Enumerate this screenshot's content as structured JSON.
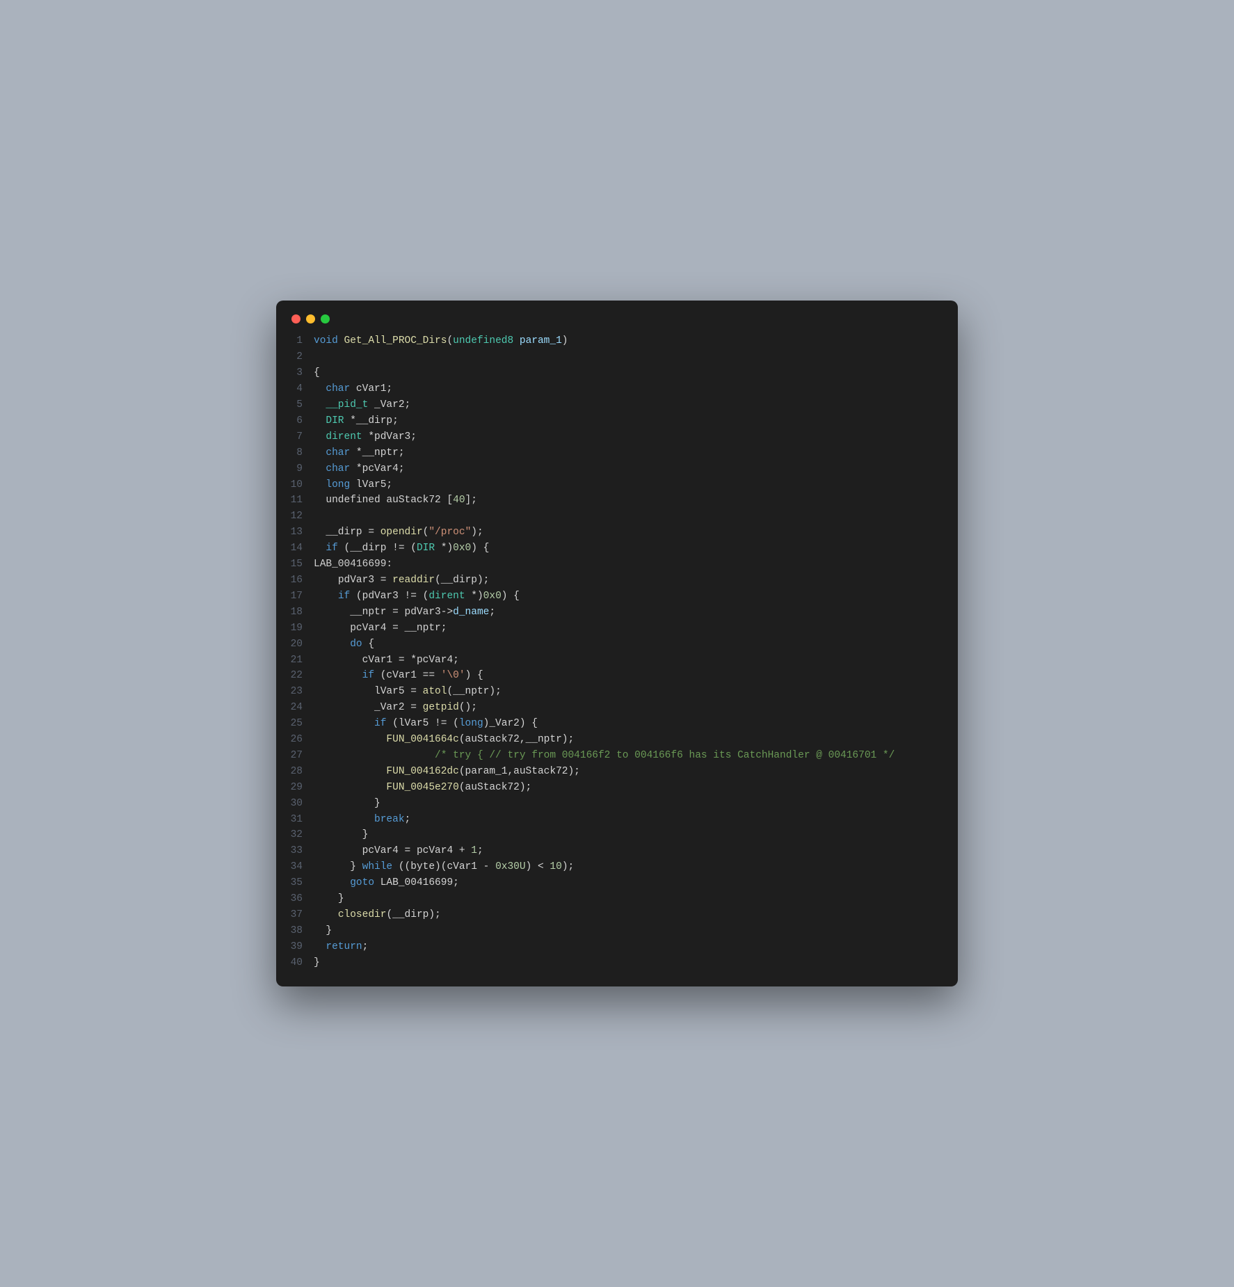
{
  "window": {
    "traffic_lights": [
      "red",
      "yellow",
      "green"
    ]
  },
  "code": {
    "lines": [
      {
        "n": 1,
        "tokens": [
          [
            "kw",
            "void"
          ],
          [
            "op",
            " "
          ],
          [
            "fn",
            "Get_All_PROC_Dirs"
          ],
          [
            "op",
            "("
          ],
          [
            "type",
            "undefined8"
          ],
          [
            "op",
            " "
          ],
          [
            "var",
            "param_1"
          ],
          [
            "op",
            ")"
          ]
        ]
      },
      {
        "n": 2,
        "tokens": []
      },
      {
        "n": 3,
        "tokens": [
          [
            "op",
            "{"
          ]
        ]
      },
      {
        "n": 4,
        "tokens": [
          [
            "op",
            "  "
          ],
          [
            "kw",
            "char"
          ],
          [
            "op",
            " cVar1;"
          ]
        ]
      },
      {
        "n": 5,
        "tokens": [
          [
            "op",
            "  "
          ],
          [
            "type",
            "__pid_t"
          ],
          [
            "op",
            " _Var2;"
          ]
        ]
      },
      {
        "n": 6,
        "tokens": [
          [
            "op",
            "  "
          ],
          [
            "type",
            "DIR"
          ],
          [
            "op",
            " *__dirp;"
          ]
        ]
      },
      {
        "n": 7,
        "tokens": [
          [
            "op",
            "  "
          ],
          [
            "type",
            "dirent"
          ],
          [
            "op",
            " *pdVar3;"
          ]
        ]
      },
      {
        "n": 8,
        "tokens": [
          [
            "op",
            "  "
          ],
          [
            "kw",
            "char"
          ],
          [
            "op",
            " *__nptr;"
          ]
        ]
      },
      {
        "n": 9,
        "tokens": [
          [
            "op",
            "  "
          ],
          [
            "kw",
            "char"
          ],
          [
            "op",
            " *pcVar4;"
          ]
        ]
      },
      {
        "n": 10,
        "tokens": [
          [
            "op",
            "  "
          ],
          [
            "kw",
            "long"
          ],
          [
            "op",
            " lVar5;"
          ]
        ]
      },
      {
        "n": 11,
        "tokens": [
          [
            "op",
            "  undefined auStack72 ["
          ],
          [
            "num",
            "40"
          ],
          [
            "op",
            "];"
          ]
        ]
      },
      {
        "n": 12,
        "tokens": []
      },
      {
        "n": 13,
        "tokens": [
          [
            "op",
            "  __dirp = "
          ],
          [
            "fn",
            "opendir"
          ],
          [
            "op",
            "("
          ],
          [
            "str",
            "\"/proc\""
          ],
          [
            "op",
            ");"
          ]
        ]
      },
      {
        "n": 14,
        "tokens": [
          [
            "op",
            "  "
          ],
          [
            "kw",
            "if"
          ],
          [
            "op",
            " (__dirp != ("
          ],
          [
            "type",
            "DIR"
          ],
          [
            "op",
            " *)"
          ],
          [
            "num",
            "0x0"
          ],
          [
            "op",
            ") {"
          ]
        ]
      },
      {
        "n": 15,
        "tokens": [
          [
            "lbl",
            "LAB_00416699:"
          ]
        ]
      },
      {
        "n": 16,
        "tokens": [
          [
            "op",
            "    pdVar3 = "
          ],
          [
            "fn",
            "readdir"
          ],
          [
            "op",
            "(__dirp);"
          ]
        ]
      },
      {
        "n": 17,
        "tokens": [
          [
            "op",
            "    "
          ],
          [
            "kw",
            "if"
          ],
          [
            "op",
            " (pdVar3 != ("
          ],
          [
            "type",
            "dirent"
          ],
          [
            "op",
            " *)"
          ],
          [
            "num",
            "0x0"
          ],
          [
            "op",
            ") {"
          ]
        ]
      },
      {
        "n": 18,
        "tokens": [
          [
            "op",
            "      __nptr = pdVar3->"
          ],
          [
            "var",
            "d_name"
          ],
          [
            "op",
            ";"
          ]
        ]
      },
      {
        "n": 19,
        "tokens": [
          [
            "op",
            "      pcVar4 = __nptr;"
          ]
        ]
      },
      {
        "n": 20,
        "tokens": [
          [
            "op",
            "      "
          ],
          [
            "kw",
            "do"
          ],
          [
            "op",
            " {"
          ]
        ]
      },
      {
        "n": 21,
        "tokens": [
          [
            "op",
            "        cVar1 = *pcVar4;"
          ]
        ]
      },
      {
        "n": 22,
        "tokens": [
          [
            "op",
            "        "
          ],
          [
            "kw",
            "if"
          ],
          [
            "op",
            " (cVar1 == "
          ],
          [
            "str",
            "'\\0'"
          ],
          [
            "op",
            ") {"
          ]
        ]
      },
      {
        "n": 23,
        "tokens": [
          [
            "op",
            "          lVar5 = "
          ],
          [
            "fn",
            "atol"
          ],
          [
            "op",
            "(__nptr);"
          ]
        ]
      },
      {
        "n": 24,
        "tokens": [
          [
            "op",
            "          _Var2 = "
          ],
          [
            "fn",
            "getpid"
          ],
          [
            "op",
            "();"
          ]
        ]
      },
      {
        "n": 25,
        "tokens": [
          [
            "op",
            "          "
          ],
          [
            "kw",
            "if"
          ],
          [
            "op",
            " (lVar5 != ("
          ],
          [
            "kw",
            "long"
          ],
          [
            "op",
            ")_Var2) {"
          ]
        ]
      },
      {
        "n": 26,
        "tokens": [
          [
            "op",
            "            "
          ],
          [
            "fn",
            "FUN_0041664c"
          ],
          [
            "op",
            "(auStack72,__nptr);"
          ]
        ]
      },
      {
        "n": 27,
        "tokens": [
          [
            "op",
            "                    "
          ],
          [
            "cmt",
            "/* try { // try from 004166f2 to 004166f6 has its CatchHandler @ 00416701 */"
          ]
        ]
      },
      {
        "n": 28,
        "tokens": [
          [
            "op",
            "            "
          ],
          [
            "fn",
            "FUN_004162dc"
          ],
          [
            "op",
            "(param_1,auStack72);"
          ]
        ]
      },
      {
        "n": 29,
        "tokens": [
          [
            "op",
            "            "
          ],
          [
            "fn",
            "FUN_0045e270"
          ],
          [
            "op",
            "(auStack72);"
          ]
        ]
      },
      {
        "n": 30,
        "tokens": [
          [
            "op",
            "          }"
          ]
        ]
      },
      {
        "n": 31,
        "tokens": [
          [
            "op",
            "          "
          ],
          [
            "kw",
            "break"
          ],
          [
            "op",
            ";"
          ]
        ]
      },
      {
        "n": 32,
        "tokens": [
          [
            "op",
            "        }"
          ]
        ]
      },
      {
        "n": 33,
        "tokens": [
          [
            "op",
            "        pcVar4 = pcVar4 + "
          ],
          [
            "num",
            "1"
          ],
          [
            "op",
            ";"
          ]
        ]
      },
      {
        "n": 34,
        "tokens": [
          [
            "op",
            "      } "
          ],
          [
            "kw",
            "while"
          ],
          [
            "op",
            " ((byte)(cVar1 - "
          ],
          [
            "num",
            "0x30U"
          ],
          [
            "op",
            ") < "
          ],
          [
            "num",
            "10"
          ],
          [
            "op",
            ");"
          ]
        ]
      },
      {
        "n": 35,
        "tokens": [
          [
            "op",
            "      "
          ],
          [
            "kw",
            "goto"
          ],
          [
            "op",
            " LAB_00416699;"
          ]
        ]
      },
      {
        "n": 36,
        "tokens": [
          [
            "op",
            "    }"
          ]
        ]
      },
      {
        "n": 37,
        "tokens": [
          [
            "op",
            "    "
          ],
          [
            "fn",
            "closedir"
          ],
          [
            "op",
            "(__dirp);"
          ]
        ]
      },
      {
        "n": 38,
        "tokens": [
          [
            "op",
            "  }"
          ]
        ]
      },
      {
        "n": 39,
        "tokens": [
          [
            "op",
            "  "
          ],
          [
            "kw",
            "return"
          ],
          [
            "op",
            ";"
          ]
        ]
      },
      {
        "n": 40,
        "tokens": [
          [
            "op",
            "}"
          ]
        ]
      }
    ]
  }
}
